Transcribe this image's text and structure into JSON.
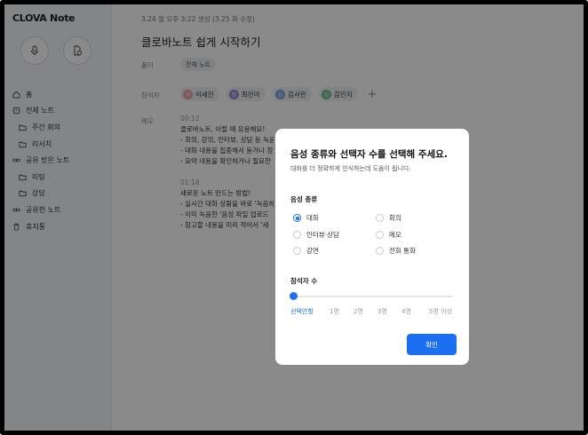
{
  "sidebar": {
    "logo": "CLOVA Note",
    "nav": [
      {
        "label": "홈",
        "icon": "home-icon"
      },
      {
        "label": "전체 노트",
        "icon": "notes-icon"
      },
      {
        "label": "주간 회의",
        "icon": "folder-icon"
      },
      {
        "label": "리서치",
        "icon": "folder-icon"
      },
      {
        "label": "공유 받은 노트",
        "icon": "shared-link-icon"
      },
      {
        "label": "미팅",
        "icon": "folder-icon"
      },
      {
        "label": "상담",
        "icon": "folder-icon"
      },
      {
        "label": "공유한 노트",
        "icon": "shared-link-icon"
      },
      {
        "label": "휴지통",
        "icon": "trash-icon"
      }
    ]
  },
  "note": {
    "meta": "3.24 월 오후 3:22 생성 (3.25 화 수정)",
    "title": "클로바노트 쉽게 시작하기",
    "folder_label": "폴더",
    "folder_value": "전체 노트",
    "participants_label": "참석자",
    "participants": [
      {
        "name": "이세진",
        "initial": "이",
        "color": "#e9a3a0"
      },
      {
        "name": "최민아",
        "initial": "최",
        "color": "#9b88d8"
      },
      {
        "name": "김서린",
        "initial": "김",
        "color": "#7aa0e6"
      },
      {
        "name": "김민지",
        "initial": "김",
        "color": "#6fbf8a"
      }
    ],
    "add_participant": "+",
    "memo_label": "메모",
    "memo_lines": [
      "00:12",
      "클로바노트, 이럴 때 유용해요!",
      "- 회의, 강의, 인터뷰, 상담 등 녹음",
      "- 대화 내용을 집중해서 듣거나 정",
      "- 요약 내용을 확인하거나 필요한",
      "",
      "01:18",
      "새로운 노트 만드는 방법!",
      "- 실시간 대화 상황을 바로 '녹음하",
      "- 이미 녹음한 '음성 파일 업로드",
      "- 참고할 내용을 미리 적어서 '새"
    ]
  },
  "modal": {
    "title": "음성 종류와 선택자 수를 선택해 주세요.",
    "subtitle": "대화를 더 정확하게 인식하는데 도움이 됩니다.",
    "voice_type_label": "음성 종류",
    "voice_options": [
      "대화",
      "회의",
      "인터뷰·상담",
      "메모",
      "강연",
      "전화 통화"
    ],
    "selected_voice": "대화",
    "participant_count_label": "참석자 수",
    "slider_ticks": [
      "선택안함",
      "1명",
      "2명",
      "3명",
      "4명",
      "5명 이상"
    ],
    "slider_value": "선택안함",
    "confirm_label": "확인",
    "accent_color": "#1c6ff0"
  }
}
